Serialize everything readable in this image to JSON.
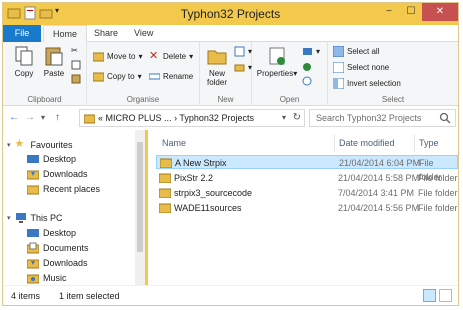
{
  "window": {
    "title": "Typhon32 Projects"
  },
  "window_controls": {
    "minimize": "−",
    "maximize": "☐",
    "close": "✕"
  },
  "tabs": [
    "File",
    "Home",
    "Share",
    "View"
  ],
  "ribbon": {
    "clipboard": {
      "label": "Clipboard",
      "copy": "Copy",
      "paste": "Paste"
    },
    "organise": {
      "label": "Organise",
      "move_to": "Move to",
      "copy_to": "Copy to",
      "delete": "Delete",
      "rename": "Rename"
    },
    "new": {
      "label": "New",
      "new_folder": "New folder"
    },
    "open": {
      "label": "Open",
      "properties": "Properties"
    },
    "select": {
      "label": "Select",
      "select_all": "Select all",
      "select_none": "Select none",
      "invert_selection": "Invert selection"
    }
  },
  "address": {
    "prefix": "«",
    "path": [
      "MICRO PLUS ...",
      "Typhon32 Projects"
    ],
    "separator": "›",
    "search_placeholder": "Search Typhon32 Projects"
  },
  "nav": {
    "favourites": {
      "label": "Favourites",
      "items": [
        "Desktop",
        "Downloads",
        "Recent places"
      ]
    },
    "this_pc": {
      "label": "This PC",
      "items": [
        "Desktop",
        "Documents",
        "Downloads",
        "Music"
      ]
    }
  },
  "columns": {
    "name": "Name",
    "date": "Date modified",
    "type": "Type"
  },
  "files": [
    {
      "name": "A New Strpix",
      "date": "21/04/2014 6:04 PM",
      "type": "File folder",
      "selected": true
    },
    {
      "name": "PixStr 2.2",
      "date": "21/04/2014 5:58 PM",
      "type": "File folder",
      "selected": false
    },
    {
      "name": "strpix3_sourcecode",
      "date": "7/04/2014 3:41 PM",
      "type": "File folder",
      "selected": false
    },
    {
      "name": "WADE11sources",
      "date": "21/04/2014 5:56 PM",
      "type": "File folder",
      "selected": false
    }
  ],
  "status": {
    "count": "4 items",
    "selected": "1 item selected"
  },
  "colors": {
    "accent": "#1979ca",
    "titlebar": "#f2c94c",
    "selection": "#cce8ff",
    "folder": "#e8bc4b"
  }
}
